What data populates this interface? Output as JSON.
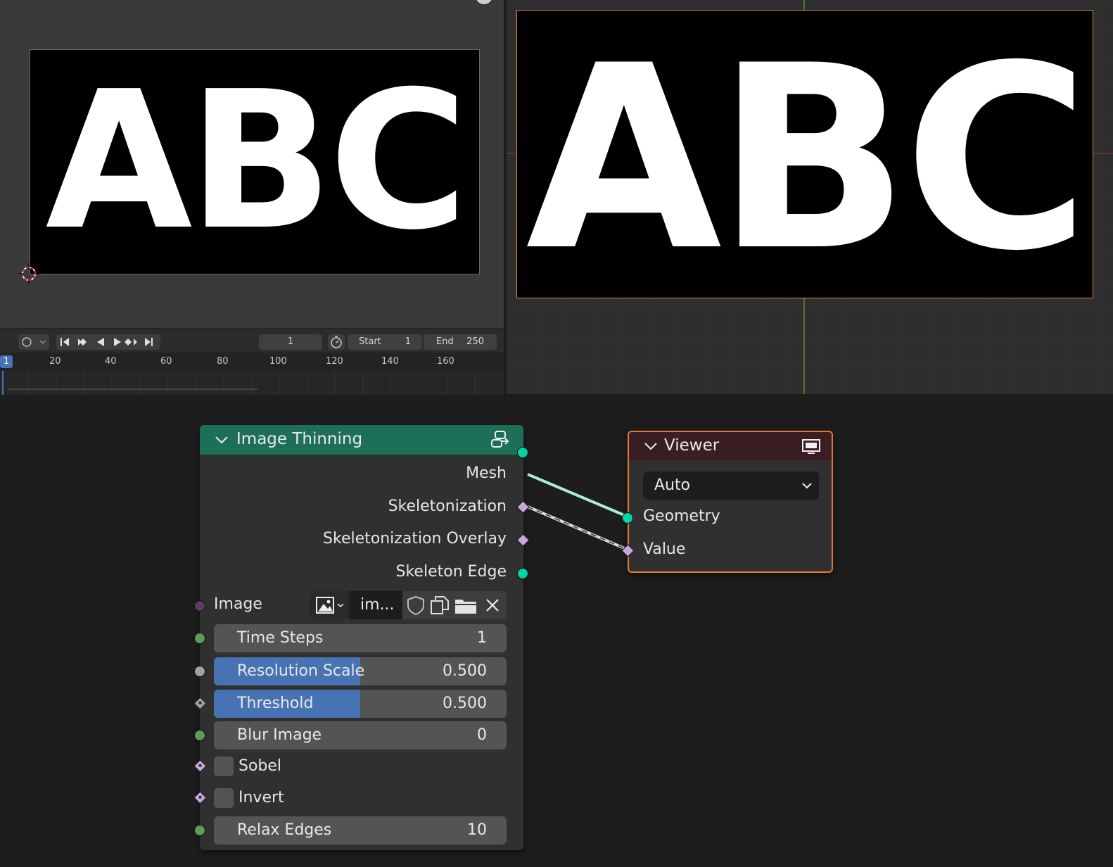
{
  "viewport_left": {
    "image_text": "ABC"
  },
  "viewport_right": {
    "image_text": "ABC"
  },
  "timeline": {
    "current_frame": "1",
    "start_label": "Start",
    "start_value": "1",
    "end_label": "End",
    "end_value": "250",
    "playhead_frame": "1",
    "ruler_ticks": [
      "20",
      "40",
      "60",
      "80",
      "100",
      "120",
      "140",
      "160"
    ]
  },
  "node_image_thinning": {
    "title": "Image Thinning",
    "outputs": [
      "Mesh",
      "Skeletonization",
      "Skeletonization Overlay",
      "Skeleton Edge"
    ],
    "image_label": "Image",
    "image_name": "im...",
    "time_steps": {
      "label": "Time Steps",
      "value": "1"
    },
    "resolution_scale": {
      "label": "Resolution Scale",
      "value": "0.500",
      "fraction": 0.5
    },
    "threshold": {
      "label": "Threshold",
      "value": "0.500",
      "fraction": 0.5
    },
    "blur_image": {
      "label": "Blur Image",
      "value": "0"
    },
    "sobel": {
      "label": "Sobel",
      "checked": false
    },
    "invert": {
      "label": "Invert",
      "checked": false
    },
    "relax_edges": {
      "label": "Relax Edges",
      "value": "10"
    }
  },
  "node_viewer": {
    "title": "Viewer",
    "domain_select": "Auto",
    "inputs": [
      "Geometry",
      "Value"
    ]
  },
  "colors": {
    "thinning_header": "#1e6f5a",
    "viewer_header": "#3a1e24",
    "viewer_border": "#e07a32",
    "geometry_socket": "#00d6a3",
    "field_socket": "#c9a6e0",
    "slider_fill": "#4772b3"
  }
}
